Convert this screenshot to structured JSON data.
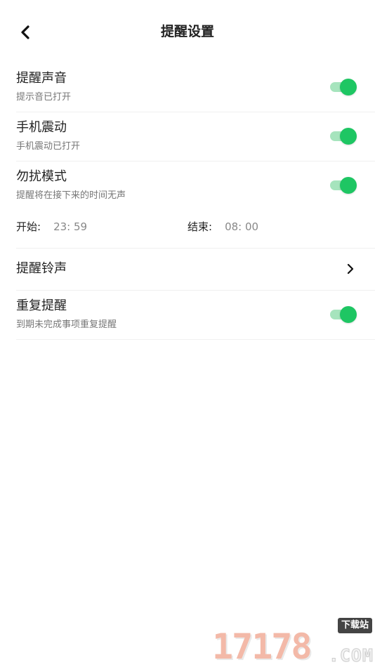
{
  "header": {
    "title": "提醒设置",
    "back_icon": "chevron-left-icon"
  },
  "settings": {
    "sound": {
      "title": "提醒声音",
      "subtitle": "提示音已打开",
      "enabled": true
    },
    "vibrate": {
      "title": "手机震动",
      "subtitle": "手机震动已打开",
      "enabled": true
    },
    "dnd": {
      "title": "勿扰模式",
      "subtitle": "提醒将在接下来的时间无声",
      "enabled": true
    },
    "dnd_time": {
      "start_label": "开始:",
      "start_value": "23: 59",
      "end_label": "结束:",
      "end_value": "08: 00"
    },
    "ringtone": {
      "title": "提醒铃声",
      "icon": "chevron-right-icon"
    },
    "repeat": {
      "title": "重复提醒",
      "subtitle": "到期未完成事项重复提醒",
      "enabled": true
    }
  },
  "watermark": {
    "digits": "17178",
    "site_label": "下载站",
    "domain": ".COM"
  },
  "colors": {
    "toggle_on": "#1ec663",
    "toggle_track_on": "#a6e4bd",
    "text_primary": "#222222",
    "text_secondary": "#777777"
  }
}
